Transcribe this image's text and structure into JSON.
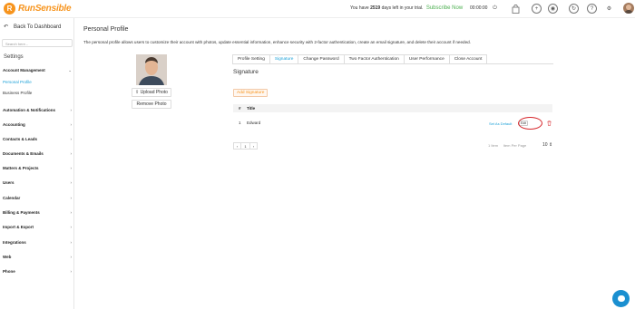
{
  "brand": {
    "name": "RunSensible"
  },
  "header": {
    "trial_prefix": "You have",
    "trial_days": "2519",
    "trial_suffix": "days left in your trial.",
    "subscribe_label": "Subscribe Now",
    "timer": "00:00:00"
  },
  "sidebar": {
    "back_label": "Back To Dashboard",
    "search_placeholder": "Search here...",
    "settings_label": "Settings",
    "account_management": "Account Management",
    "sub_items": [
      "Personal Profile",
      "Business Profile"
    ],
    "items": [
      "Automation & Notifications",
      "Accounting",
      "Contacts & Leads",
      "Documents & Emails",
      "Matters & Projects",
      "Users",
      "Calendar",
      "Billing & Payments",
      "Import & Export",
      "Integrations",
      "Web",
      "Phone"
    ]
  },
  "main": {
    "title": "Personal Profile",
    "description": "The personal profile allows users to customize their account with photos, update essential information, enhance security with 2-factor authentication, create an email signature, and delete their account if needed.",
    "upload_photo": "Upload Photo",
    "remove_photo": "Remove Photo",
    "tabs": [
      "Profile Setting",
      "Signature",
      "Change Password",
      "Two Factor Authentication",
      "User Performance",
      "Close Account"
    ],
    "active_tab": "Signature",
    "section_title": "Signature",
    "add_button": "Add Signature",
    "table": {
      "headers": [
        "#",
        "Title"
      ],
      "rows": [
        {
          "num": "1",
          "title": "Edward",
          "set_default": "Set As Default",
          "edit": "Edit"
        }
      ]
    },
    "pager": {
      "prev": "‹",
      "page": "1",
      "next": "›",
      "item_count": "1 Item",
      "per_page_label": "Item Per Page",
      "per_page_value": "10"
    }
  }
}
